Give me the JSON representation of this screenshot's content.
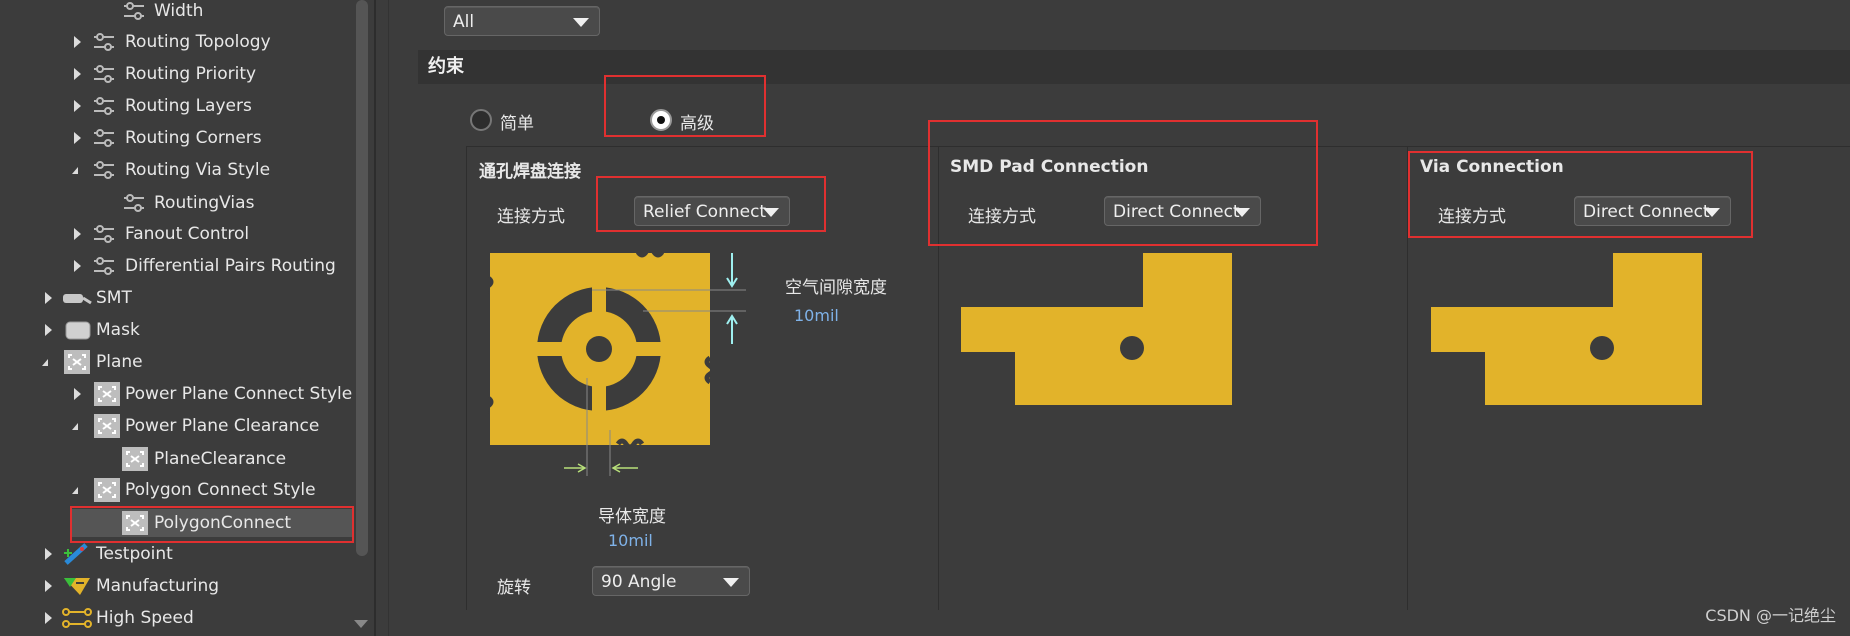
{
  "tree": {
    "items": [
      {
        "label": "Width",
        "icon": "rule-icon"
      },
      {
        "label": "Routing Topology",
        "icon": "rule-icon"
      },
      {
        "label": "Routing Priority",
        "icon": "rule-icon"
      },
      {
        "label": "Routing Layers",
        "icon": "rule-icon"
      },
      {
        "label": "Routing Corners",
        "icon": "rule-icon"
      },
      {
        "label": "Routing Via Style",
        "icon": "rule-icon"
      },
      {
        "label": "RoutingVias",
        "icon": "rule-icon"
      },
      {
        "label": "Fanout Control",
        "icon": "rule-icon"
      },
      {
        "label": "Differential Pairs Routing",
        "icon": "rule-icon"
      },
      {
        "label": "SMT",
        "icon": "smt-icon"
      },
      {
        "label": "Mask",
        "icon": "mask-icon"
      },
      {
        "label": "Plane",
        "icon": "plane-icon"
      },
      {
        "label": "Power Plane Connect Style",
        "icon": "plane-icon"
      },
      {
        "label": "Power Plane Clearance",
        "icon": "plane-icon"
      },
      {
        "label": "PlaneClearance",
        "icon": "plane-icon"
      },
      {
        "label": "Polygon Connect Style",
        "icon": "plane-icon"
      },
      {
        "label": "PolygonConnect",
        "icon": "plane-icon"
      },
      {
        "label": "Testpoint",
        "icon": "testpoint-icon"
      },
      {
        "label": "Manufacturing",
        "icon": "manufacturing-icon"
      },
      {
        "label": "High Speed",
        "icon": "highspeed-icon"
      }
    ]
  },
  "filter": {
    "value": "All"
  },
  "constraints": {
    "title": "约束",
    "mode_simple": "简单",
    "mode_advanced": "高级",
    "selected_mode": "高级"
  },
  "through_hole": {
    "title": "通孔焊盘连接",
    "connect_label": "连接方式",
    "connect_value": "Relief Connect",
    "air_gap_label": "空气间隙宽度",
    "air_gap_value": "10mil",
    "conductor_label": "导体宽度",
    "conductor_value": "10mil",
    "rotation_label": "旋转",
    "rotation_value": "90 Angle"
  },
  "smd": {
    "title": "SMD Pad Connection",
    "connect_label": "连接方式",
    "connect_value": "Direct Connect"
  },
  "via": {
    "title": "Via Connection",
    "connect_label": "连接方式",
    "connect_value": "Direct Connect"
  },
  "watermark": "CSDN @一记绝尘",
  "colors": {
    "copper": "#e2b32a",
    "highlight": "#e03030",
    "accent_text": "#7fb2e8"
  }
}
